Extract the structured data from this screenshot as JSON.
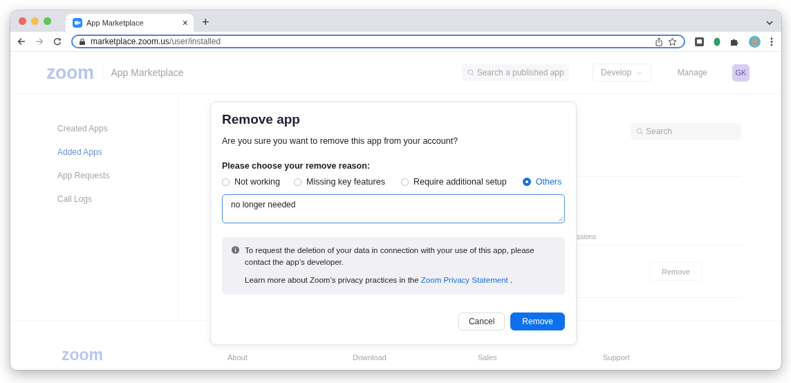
{
  "browser": {
    "tab": {
      "title": "App Marketplace",
      "close": "×"
    },
    "new_tab": "+",
    "url": {
      "host": "marketplace.zoom.us",
      "path": "/user/installed"
    }
  },
  "header": {
    "logo": "zoom",
    "title": "App Marketplace",
    "search": {
      "placeholder": "Search a published app"
    },
    "develop": "Develop",
    "manage": "Manage",
    "avatar": "GK"
  },
  "sidebar": {
    "items": [
      {
        "label": "Created Apps",
        "selected": false
      },
      {
        "label": "Added Apps",
        "selected": true
      },
      {
        "label": "App Requests",
        "selected": false
      },
      {
        "label": "Call Logs",
        "selected": false
      }
    ]
  },
  "main": {
    "search": {
      "placeholder": "Search"
    },
    "partial_text": "ssions",
    "remove_button": "Remove"
  },
  "dialog": {
    "title": "Remove app",
    "question": "Are you sure you want to remove this app from your account?",
    "reason_label": "Please choose your remove reason:",
    "reasons": [
      {
        "label": "Not working",
        "selected": false
      },
      {
        "label": "Missing key features",
        "selected": false
      },
      {
        "label": "Require additional setup",
        "selected": false
      },
      {
        "label": "Others",
        "selected": true
      }
    ],
    "comment": "no longer needed",
    "info": {
      "text": "To request the deletion of your data in connection with your use of this app, please contact the app’s developer.",
      "learn_prefix": "Learn more about Zoom’s privacy practices in the",
      "link": "Zoom Privacy Statement",
      "suffix": "."
    },
    "buttons": [
      {
        "label": "Cancel",
        "kind": "secondary"
      },
      {
        "label": "Remove",
        "kind": "primary"
      }
    ]
  },
  "footer": {
    "logo": "zoom",
    "links": [
      "About",
      "Download",
      "Sales",
      "Support"
    ]
  }
}
